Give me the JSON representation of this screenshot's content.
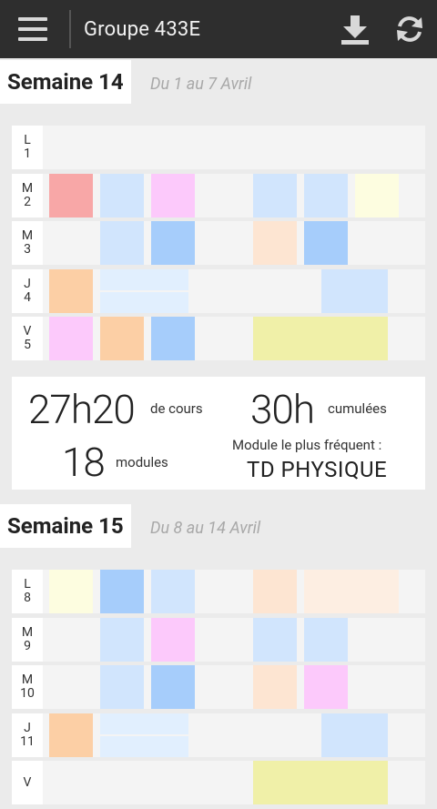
{
  "header": {
    "title": "Groupe 433E",
    "menu_icon": "hamburger-menu-icon",
    "download_icon": "download-icon",
    "refresh_icon": "refresh-icon"
  },
  "colors": {
    "appbar": "#2e2e2e",
    "red": "#f8a7a7",
    "lightblue": "#d1e5fd",
    "blue": "#a6cdfb",
    "pink": "#fcc9fb",
    "yellow": "#fdfde0",
    "peach": "#fccfa5",
    "lightpeach": "#fde5d2",
    "olive": "#f0f0a8",
    "paleblue": "#e1effe"
  },
  "weeks": [
    {
      "title": "Semaine 14",
      "range": "Du 1 au 7 Avril",
      "days": [
        {
          "letter": "L",
          "num": "1"
        },
        {
          "letter": "M",
          "num": "2"
        },
        {
          "letter": "M",
          "num": "3"
        },
        {
          "letter": "J",
          "num": "4"
        },
        {
          "letter": "V",
          "num": "5"
        }
      ]
    },
    {
      "title": "Semaine 15",
      "range": "Du 8 au 14 Avril",
      "days": [
        {
          "letter": "L",
          "num": "8"
        },
        {
          "letter": "M",
          "num": "9"
        },
        {
          "letter": "M",
          "num": "10"
        },
        {
          "letter": "J",
          "num": "11"
        },
        {
          "letter": "V",
          "num": ""
        }
      ]
    }
  ],
  "stats": {
    "hours": "27h20",
    "hours_label": "de cours",
    "cumul": "30h",
    "cumul_label": "cumulées",
    "modules": "18",
    "modules_label": "modules",
    "frequent_label": "Module le plus fréquent :",
    "frequent_value": "TD PHYSIQUE"
  }
}
